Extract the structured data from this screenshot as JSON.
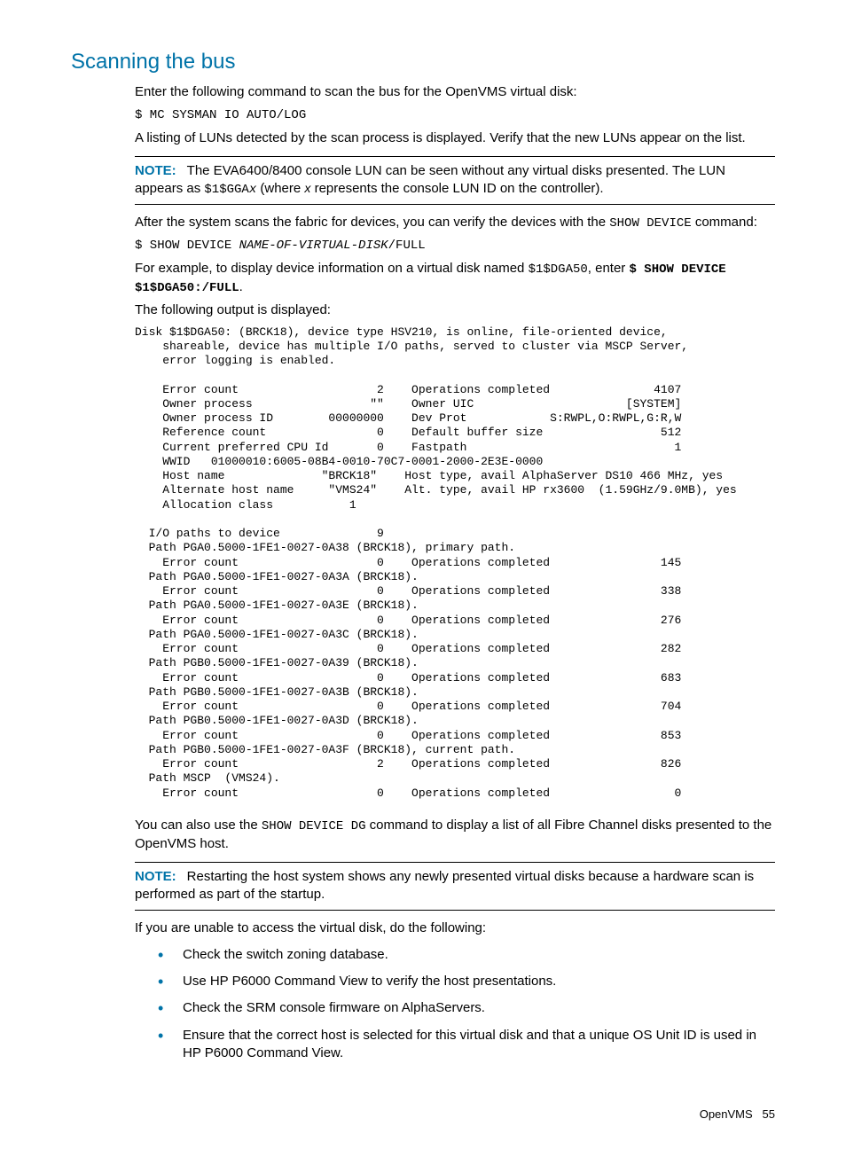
{
  "heading": "Scanning the bus",
  "p1": "Enter the following command to scan the bus for the OpenVMS virtual disk:",
  "cmd1": "$ MC SYSMAN IO AUTO/LOG",
  "p2": "A listing of LUNs detected by the scan process is displayed. Verify that the new LUNs appear on the list.",
  "note1": {
    "label": "NOTE:",
    "text_a": "The EVA6400/8400 console LUN can be seen without any virtual disks presented. The LUN appears as ",
    "code_a": "$1$GGA",
    "code_ital": "x",
    "text_b": " (where ",
    "ital_b": "x",
    "text_c": " represents the console LUN ID on the controller)."
  },
  "p3_a": "After the system scans the fabric for devices, you can verify the devices with the ",
  "p3_code": "SHOW DEVICE",
  "p3_b": " command:",
  "cmd2_a": "$ SHOW DEVICE ",
  "cmd2_ital": "NAME-OF-VIRTUAL-DISK",
  "cmd2_b": "/FULL",
  "p4_a": "For example, to display device information on a virtual disk named ",
  "p4_code": "$1$DGA50",
  "p4_b": ", enter ",
  "p4_bold": "$ SHOW DEVICE $1$DGA50:/FULL",
  "p4_c": ".",
  "p5": "The following output is displayed:",
  "terminal": "Disk $1$DGA50: (BRCK18), device type HSV210, is online, file-oriented device,\n    shareable, device has multiple I/O paths, served to cluster via MSCP Server,\n    error logging is enabled.\n\n    Error count                    2    Operations completed               4107\n    Owner process                 \"\"    Owner UIC                      [SYSTEM]\n    Owner process ID        00000000    Dev Prot            S:RWPL,O:RWPL,G:R,W\n    Reference count                0    Default buffer size                 512\n    Current preferred CPU Id       0    Fastpath                              1\n    WWID   01000010:6005-08B4-0010-70C7-0001-2000-2E3E-0000\n    Host name              \"BRCK18\"    Host type, avail AlphaServer DS10 466 MHz, yes\n    Alternate host name     \"VMS24\"    Alt. type, avail HP rx3600  (1.59GHz/9.0MB), yes\n    Allocation class           1\n\n  I/O paths to device              9\n  Path PGA0.5000-1FE1-0027-0A38 (BRCK18), primary path.\n    Error count                    0    Operations completed                145\n  Path PGA0.5000-1FE1-0027-0A3A (BRCK18).\n    Error count                    0    Operations completed                338\n  Path PGA0.5000-1FE1-0027-0A3E (BRCK18).\n    Error count                    0    Operations completed                276\n  Path PGA0.5000-1FE1-0027-0A3C (BRCK18).\n    Error count                    0    Operations completed                282\n  Path PGB0.5000-1FE1-0027-0A39 (BRCK18).\n    Error count                    0    Operations completed                683\n  Path PGB0.5000-1FE1-0027-0A3B (BRCK18).\n    Error count                    0    Operations completed                704\n  Path PGB0.5000-1FE1-0027-0A3D (BRCK18).\n    Error count                    0    Operations completed                853\n  Path PGB0.5000-1FE1-0027-0A3F (BRCK18), current path.\n    Error count                    2    Operations completed                826\n  Path MSCP  (VMS24).\n    Error count                    0    Operations completed                  0",
  "p6_a": "You can also use the ",
  "p6_code": "SHOW DEVICE DG",
  "p6_b": " command to display a list of all Fibre Channel disks presented to the OpenVMS host.",
  "note2": {
    "label": "NOTE:",
    "text": "Restarting the host system shows any newly presented virtual disks because a hardware scan is performed as part of the startup."
  },
  "p7": "If you are unable to access the virtual disk, do the following:",
  "bullets": [
    "Check the switch zoning database.",
    "Use HP P6000 Command View to verify the host presentations.",
    "Check the SRM console firmware on AlphaServers.",
    "Ensure that the correct host is selected for this virtual disk and that a unique OS Unit ID is used in HP P6000 Command View."
  ],
  "footer_section": "OpenVMS",
  "footer_page": "55"
}
